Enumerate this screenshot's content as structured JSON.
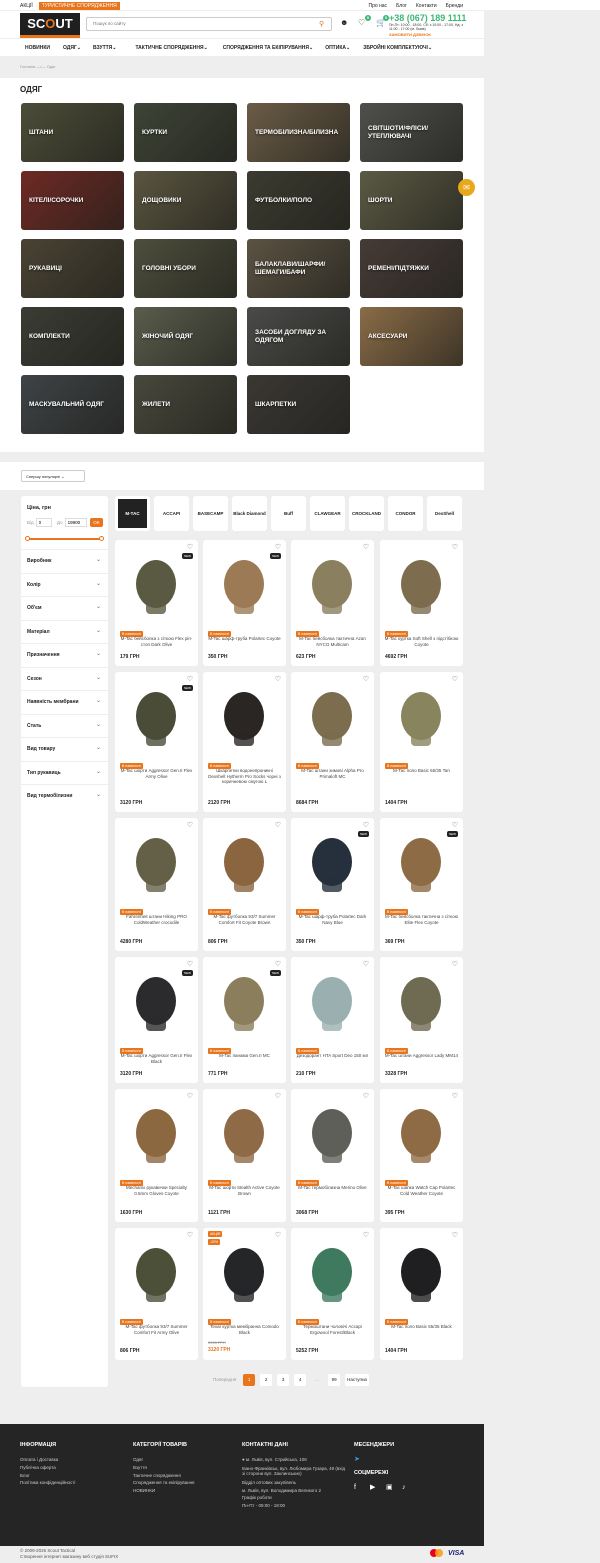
{
  "topbar": {
    "promo": "АКЦІЇ",
    "tag": "ТУРИСТИЧНЕ СПОРЯДЖЕННЯ",
    "links": [
      "Про нас",
      "Блог",
      "Контакти",
      "Бренди"
    ]
  },
  "header": {
    "logo": "SCOUT",
    "search_placeholder": "Пошук по сайту",
    "phone": "+38 (067) 189 1111",
    "hours": "Пн-Пт: 10:00 - 18:00, Сб: з 10:00 - 17:00, Нд: з 11:00 - 17:00 (м. Львів)",
    "callback": "ЗАМОВИТИ ДЗВІНОК",
    "wishlist_count": "0",
    "cart_count": "0"
  },
  "nav": [
    "НОВИНКИ",
    "ОДЯГ",
    "ВЗУТТЯ",
    "ТАКТИЧНЕ СПОРЯДЖЕННЯ",
    "СПОРЯДЖЕННЯ ТА ЕКІПІРУВАННЯ",
    "ОПТИКА",
    "ЗБРОЙНІ КОМПЛЕКТУЮЧІ"
  ],
  "breadcrumb": "Головна —•— Одяг",
  "page_title": "ОДЯГ",
  "categories": [
    {
      "label": "ШТАНИ",
      "color": "#4c4d38"
    },
    {
      "label": "КУРТКИ",
      "color": "#3e4436"
    },
    {
      "label": "ТЕРМОБІЛИЗНА/БІЛИЗНА",
      "color": "#6b5c46"
    },
    {
      "label": "СВІТШОТИ/ФЛІСИ/ УТЕПЛЮВАЧІ",
      "color": "#4f4f4c"
    },
    {
      "label": "КІТЕЛІ/СОРОЧКИ",
      "color": "#6e2a24"
    },
    {
      "label": "ДОЩОВИКИ",
      "color": "#5a5540"
    },
    {
      "label": "ФУТБОЛКИ/ПОЛО",
      "color": "#3c3b30"
    },
    {
      "label": "ШОРТИ",
      "color": "#5b5a44"
    },
    {
      "label": "РУКАВИЦІ",
      "color": "#4a4334"
    },
    {
      "label": "ГОЛОВНІ УБОРИ",
      "color": "#4d4e3c"
    },
    {
      "label": "БАЛАКЛАВИ/ШАРФИ/ ШЕМАГИ/БАФИ",
      "color": "#5b5242"
    },
    {
      "label": "РЕМЕНІ/ПІДТЯЖКИ",
      "color": "#463b36"
    },
    {
      "label": "КОМПЛЕКТИ",
      "color": "#3b3c34"
    },
    {
      "label": "ЖІНОЧИЙ ОДЯГ",
      "color": "#5a5c4c"
    },
    {
      "label": "ЗАСОБИ ДОГЛЯДУ ЗА ОДЯГОМ",
      "color": "#4a4a48"
    },
    {
      "label": "АКСЕСУАРИ",
      "color": "#8a6c47"
    },
    {
      "label": "МАСКУВАЛЬНИЙ ОДЯГ",
      "color": "#3f4346"
    },
    {
      "label": "ЖИЛЕТИ",
      "color": "#48483c"
    },
    {
      "label": "ШКАРПЕТКИ",
      "color": "#3b3834"
    }
  ],
  "sort": {
    "label": "Спершу популярні"
  },
  "filters": {
    "price_title": "Ціна, грн",
    "from_label": "Від",
    "from_value": "0",
    "to_label": "До",
    "to_value": "19900",
    "ok": "OK",
    "groups": [
      "Виробник",
      "Колір",
      "Об'єм",
      "Матеріал",
      "Призначення",
      "Сезон",
      "Наявність мембрани",
      "Стать",
      "Вид товару",
      "Тип рукавиць",
      "Вид термобілизни"
    ]
  },
  "brands": [
    "M-TAC",
    "ACCAPI",
    "BASECAMP",
    "Black Diamond",
    "Buff",
    "CLAWGEAR",
    "CROCKLAND",
    "CONDOR",
    "DexShell"
  ],
  "stock_label": "В наявності",
  "new_label": "NEW",
  "products": [
    {
      "name": "M-Tac бейсболка з сіткою Flex ріп-стоп Dark Olive",
      "price": "179 ГРН",
      "color": "#5a5a42",
      "new": true
    },
    {
      "name": "M-Tac шарф-труба Polartec Coyote",
      "price": "350 ГРН",
      "color": "#9b7a55",
      "new": true
    },
    {
      "name": "M-Tac бейсболка тактична Azan NYCO Multicam",
      "price": "623 ГРН",
      "color": "#8a7f5e",
      "new": false
    },
    {
      "name": "M-Tac куртка Soft Shell з підстібкою Coyote",
      "price": "4692 ГРН",
      "color": "#7d6c4d",
      "new": false
    },
    {
      "name": "M-Tac шорти Aggressor Gen.II Flex Army Olive",
      "price": "3120 ГРН",
      "color": "#4a4c38",
      "new": true
    },
    {
      "name": "Шкарпетки водонепроникні Dexshell Hytherm Pro Socks чорні з коричневою смугою L",
      "price": "2120 ГРН",
      "color": "#2a2624",
      "new": false
    },
    {
      "name": "M-Tac штани зимові Alpha Pro Primaloft MC",
      "price": "8684 ГРН",
      "color": "#7b6d4d",
      "new": false
    },
    {
      "name": "M-Tac поло Basic 65/35 Tan",
      "price": "1404 ГРН",
      "color": "#87845e",
      "new": false
    },
    {
      "name": "Fahrenheit штани Hiking PRO ColdWeather crocodile",
      "price": "4280 ГРН",
      "color": "#646048",
      "new": false
    },
    {
      "name": "M-Tac футболка 93/7 Summer Comfort Fit Coyote Brown",
      "price": "806 ГРН",
      "color": "#8a6540",
      "new": false
    },
    {
      "name": "M-Tac шарф-труба Polartec Dark Navy Blue",
      "price": "350 ГРН",
      "color": "#26303c",
      "new": true
    },
    {
      "name": "M-Tac бейсболка тактична з сіткою Elite Flex Coyote",
      "price": "369 ГРН",
      "color": "#8c6b45",
      "new": true
    },
    {
      "name": "M-Tac шорти Aggressor Gen.II Flex Black",
      "price": "3120 ГРН",
      "color": "#2b2b2d",
      "new": true
    },
    {
      "name": "M-Tac панама Gen.II MC",
      "price": "771 ГРН",
      "color": "#8b7e5c",
      "new": true
    },
    {
      "name": "Дезодорант HTA Sport Deo 150 мл",
      "price": "210 ГРН",
      "color": "#9ab0b0",
      "new": false
    },
    {
      "name": "M-Tac штани Aggressor Lady MM14",
      "price": "3328 ГРН",
      "color": "#6f6a52",
      "new": false
    },
    {
      "name": "Mechanix рукавички Specialty 0.5mm Gloves Coyote",
      "price": "1630 ГРН",
      "color": "#8c6841",
      "new": false
    },
    {
      "name": "M-Tac шорти Stealth Active Coyote Brown",
      "price": "1121 ГРН",
      "color": "#8e6a46",
      "new": false
    },
    {
      "name": "M-Tac термобілизна Merino Olive",
      "price": "3068 ГРН",
      "color": "#5e5f58",
      "new": false
    },
    {
      "name": "M-Tac шапка Watch Cap Polartec Cold Weather Coyote",
      "price": "395 ГРН",
      "color": "#8e6b45",
      "new": false
    },
    {
      "name": "M-Tac футболка 93/7 Summer Comfort Fit Army Olive",
      "price": "806 ГРН",
      "color": "#4d5039",
      "new": false
    },
    {
      "name": "Texar куртка мембранна Comodo Black",
      "price": "3120 ГРН",
      "old_price": "3900 ГРН",
      "sale": "АКЦІЯ",
      "discount": "-20%",
      "color": "#242628",
      "new": false
    },
    {
      "name": "Термоштани чоловічі Accapi Ergowool Forest/Black",
      "price": "5252 ГРН",
      "color": "#3f7a5e",
      "new": false
    },
    {
      "name": "M-Tac поло Basic 65/35 Black",
      "price": "1404 ГРН",
      "color": "#1f1f21",
      "new": false
    }
  ],
  "pagination": {
    "prev": "Попередня",
    "pages": [
      "1",
      "2",
      "3",
      "4",
      "...",
      "99"
    ],
    "next": "Наступна"
  },
  "footer": {
    "info_title": "ІНФОРМАЦІЯ",
    "info": [
      "Оплата і Доставка",
      "Публічна оферта",
      "Блог",
      "Політика конфіденційності"
    ],
    "cats_title": "КАТЕГОРІЇ ТОВАРІВ",
    "cats": [
      "Одяг",
      "Взуття",
      "Тактичне спорядження",
      "Спорядження та екіпірування",
      "НОВИНКИ"
    ],
    "contact_title": "КОНТАКТНІ ДАНІ",
    "contacts": [
      "м. Львів, вул. Стрийська, 108",
      "Івано-Франківськ, вул. Любомира Гузара, 49 (вхід зі сторони вул. Заклинських)",
      "Відділ оптових закупівель",
      "м. Львів, вул. Володимира Великого 2",
      "Графік роботи",
      "Пн-Пт - 09:00 - 18:00"
    ],
    "messengers_title": "МЕСЕНДЖЕРИ",
    "social_title": "СОЦМЕРЕЖІ"
  },
  "copyright": [
    "© 2009-2026 Scout Tactical",
    "Створення інтернет магазину веб студія SUFIX"
  ],
  "payments": [
    "mastercard",
    "VISA"
  ]
}
